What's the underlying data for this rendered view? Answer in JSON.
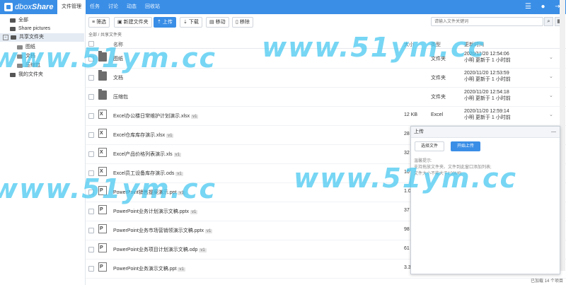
{
  "app": {
    "logo_prefix": "dbox",
    "logo_suffix": "Share"
  },
  "nav": {
    "items": [
      "文件管理",
      "任务",
      "讨论",
      "动态",
      "回收站"
    ]
  },
  "sidebar": {
    "items": [
      {
        "label": "全部"
      },
      {
        "label": "Share pictures"
      },
      {
        "label": "共享文件夹"
      },
      {
        "label": "图纸"
      },
      {
        "label": "文档"
      },
      {
        "label": "压缩包"
      },
      {
        "label": "我的文件夹"
      }
    ]
  },
  "toolbar": {
    "filter": "筛选",
    "new_folder": "新建文件夹",
    "upload": "上传",
    "download": "下载",
    "move": "移动",
    "remove": "移除",
    "search_placeholder": "请输入文件关键词"
  },
  "breadcrumb": "全部 / 共享文件夹",
  "table": {
    "headers": {
      "name": "名称",
      "size": "大小",
      "type": "类型",
      "updated": "更新时间"
    },
    "rows": [
      {
        "name": "图纸",
        "ver": "",
        "size": "",
        "type": "文件夹",
        "date": "2020/11/20 12:54:06",
        "user": "小明 更新于 1 小时前",
        "icon": "folder"
      },
      {
        "name": "文档",
        "ver": "",
        "size": "",
        "type": "文件夹",
        "date": "2020/11/20 12:53:59",
        "user": "小明 更新于 1 小时前",
        "icon": "folder"
      },
      {
        "name": "压缩包",
        "ver": "",
        "size": "",
        "type": "文件夹",
        "date": "2020/11/20 12:54:18",
        "user": "小明 更新于 1 小时前",
        "icon": "folder"
      },
      {
        "name": "Excel办公楼日常维护计划演示.xlsx",
        "ver": "v1",
        "size": "12 KB",
        "type": "Excel",
        "date": "2020/11/20 12:59:14",
        "user": "小明 更新于 1 小时前",
        "icon": "excel"
      },
      {
        "name": "Excel仓库库存演示.xlsx",
        "ver": "v1",
        "size": "28",
        "type": "",
        "date": "",
        "user": "",
        "icon": "excel"
      },
      {
        "name": "Excel产品价格列表演示.xls",
        "ver": "v1",
        "size": "32",
        "type": "",
        "date": "",
        "user": "",
        "icon": "excel"
      },
      {
        "name": "Excel员工设备库存演示.ods",
        "ver": "v1",
        "size": "10",
        "type": "",
        "date": "",
        "user": "",
        "icon": "excel"
      },
      {
        "name": "PowerPoint销售提案演示.ppt",
        "ver": "v1",
        "size": "1.0",
        "type": "",
        "date": "",
        "user": "",
        "icon": "ppt"
      },
      {
        "name": "PowerPoint业务计划演示文稿.pptx",
        "ver": "v1",
        "size": "37",
        "type": "",
        "date": "",
        "user": "",
        "icon": "ppt"
      },
      {
        "name": "PowerPoint业务市场营销领演示文稿.pptx",
        "ver": "v1",
        "size": "98",
        "type": "",
        "date": "",
        "user": "",
        "icon": "ppt"
      },
      {
        "name": "PowerPoint业务项目计划演示文稿.odp",
        "ver": "v1",
        "size": "61",
        "type": "",
        "date": "",
        "user": "",
        "icon": "ppt"
      },
      {
        "name": "PowerPoint业务演示文稿.ppt",
        "ver": "v1",
        "size": "3.3",
        "type": "",
        "date": "",
        "user": "",
        "icon": "ppt"
      }
    ]
  },
  "status": "已加载 14 个项目",
  "upload_panel": {
    "title": "上传",
    "close": "—",
    "select_btn": "选择文件",
    "start_btn": "开始上传",
    "hints": [
      "温馨提示:",
      "支持拖放文件夹、文件到此窗口添加列表;",
      "文件大小不能大于100MB;"
    ]
  },
  "watermark": "www.51ym.cc"
}
